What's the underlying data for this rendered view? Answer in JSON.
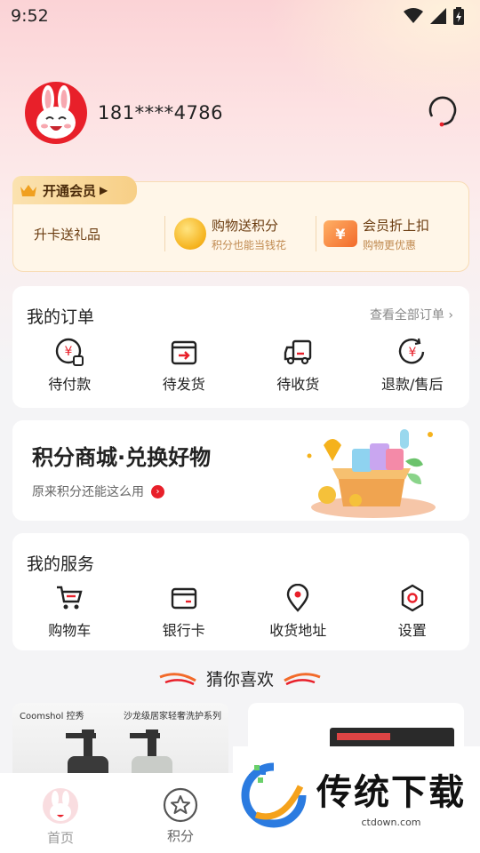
{
  "status_bar": {
    "time": "9:52"
  },
  "profile": {
    "phone": "181****4786"
  },
  "vip": {
    "tag_label": "开通会员",
    "items": [
      {
        "title": "升卡送礼品"
      },
      {
        "title": "购物送积分",
        "subtitle": "积分也能当钱花"
      },
      {
        "title": "会员折上扣",
        "subtitle": "购物更优惠"
      }
    ]
  },
  "orders": {
    "title": "我的订单",
    "more_label": "查看全部订单",
    "items": [
      {
        "label": "待付款",
        "icon": "payment-pending-icon"
      },
      {
        "label": "待发货",
        "icon": "to-ship-icon"
      },
      {
        "label": "待收货",
        "icon": "truck-icon"
      },
      {
        "label": "退款/售后",
        "icon": "refund-icon"
      }
    ]
  },
  "mall": {
    "title": "积分商城·兑换好物",
    "subtitle": "原来积分还能这么用"
  },
  "services": {
    "title": "我的服务",
    "items": [
      {
        "label": "购物车",
        "icon": "cart-icon"
      },
      {
        "label": "银行卡",
        "icon": "bank-card-icon"
      },
      {
        "label": "收货地址",
        "icon": "location-icon"
      },
      {
        "label": "设置",
        "icon": "gear-icon"
      }
    ]
  },
  "guess": {
    "title": "猜你喜欢"
  },
  "products": [
    {
      "brand": "Coomshol 控秀",
      "slogan": "沙龙级居家轻奢洗护系列"
    }
  ],
  "tabbar": {
    "tabs": [
      {
        "label": "首页"
      },
      {
        "label": "积分"
      }
    ]
  },
  "watermark": {
    "title": "传统下载",
    "url": "ctdown.com"
  },
  "colors": {
    "brand_red": "#e8202a",
    "gold": "#f5b21c"
  }
}
